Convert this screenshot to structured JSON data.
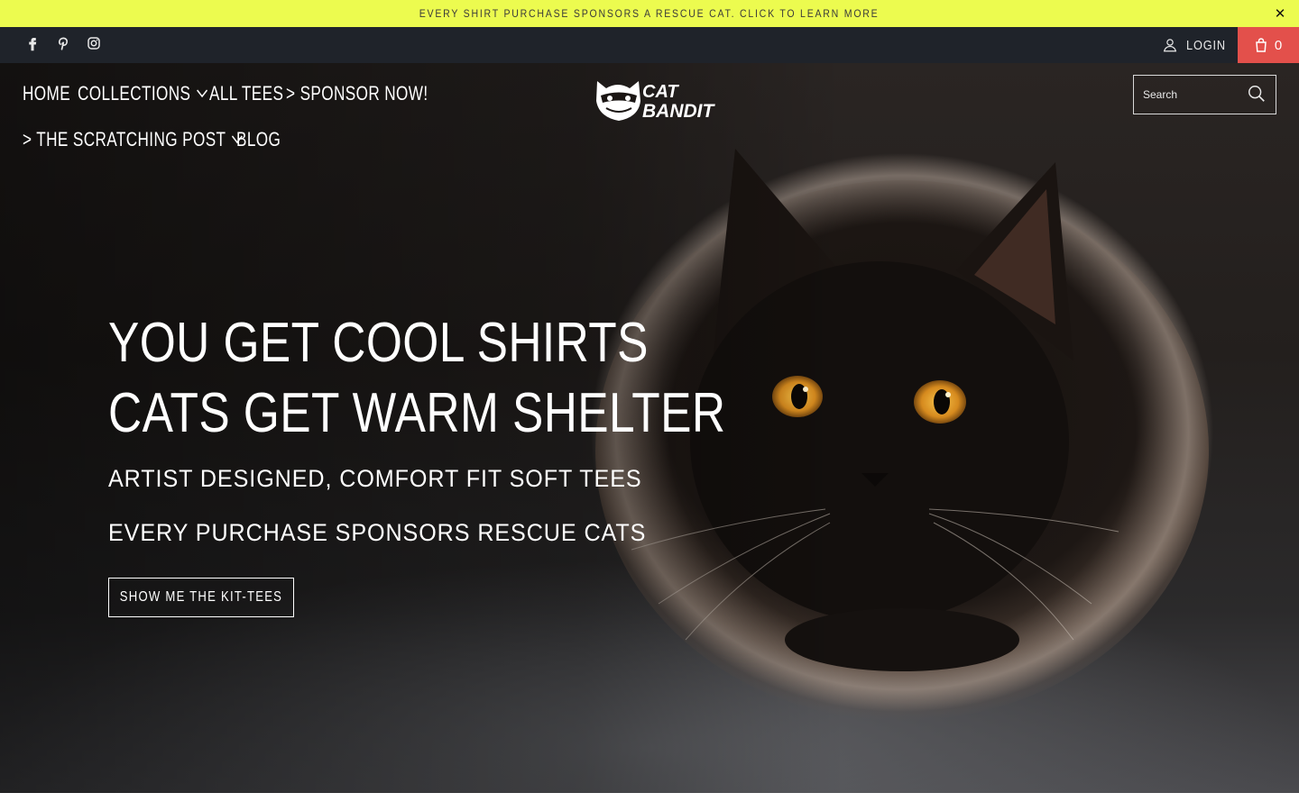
{
  "announcement": {
    "text": "EVERY SHIRT PURCHASE SPONSORS A RESCUE CAT. CLICK TO LEARN MORE",
    "close_glyph": "✕",
    "background": "#ecfb4f"
  },
  "topbar": {
    "background": "#1f232a",
    "social_icons": [
      "facebook-icon",
      "pinterest-icon",
      "instagram-icon"
    ],
    "login_label": "LOGIN",
    "cart_count": "0",
    "cart_background": "#e3504b"
  },
  "nav": {
    "items": [
      {
        "label": "HOME"
      },
      {
        "label": "COLLECTIONS",
        "has_dropdown": true
      },
      {
        "label": "ALL TEES"
      },
      {
        "label": "> SPONSOR NOW!"
      },
      {
        "label": "> THE SCRATCHING POST",
        "has_dropdown": true
      },
      {
        "label": "BLOG"
      }
    ]
  },
  "logo": {
    "line1": "CAT",
    "line2": "BANDIT"
  },
  "search": {
    "placeholder": "Search"
  },
  "hero": {
    "headline_1": "YOU GET COOL SHIRTS",
    "headline_2": "CATS GET WARM SHELTER",
    "subline_1": "ARTIST DESIGNED, COMFORT FIT SOFT TEES",
    "subline_2": "EVERY PURCHASE SPONSORS RESCUE CATS",
    "cta_label": "SHOW ME THE KIT-TEES"
  }
}
